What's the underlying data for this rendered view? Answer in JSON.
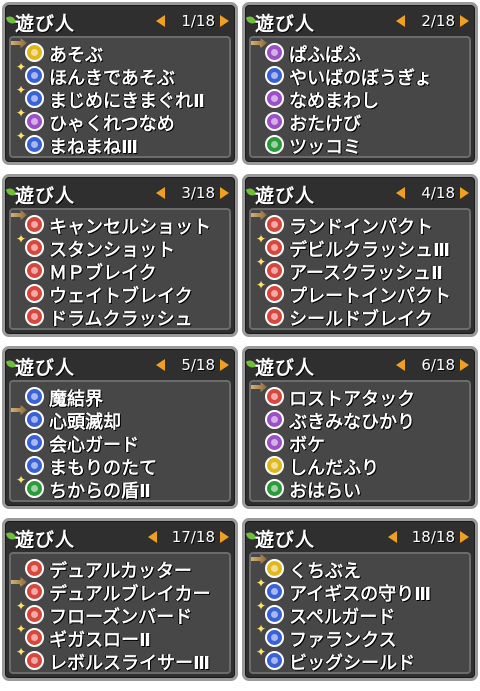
{
  "colors": {
    "red": "#d9463c",
    "blue": "#3a62d8",
    "yellow": "#e1b81c",
    "purple": "#9d4fc7",
    "green": "#2a9a3a"
  },
  "panels": [
    {
      "title": "遊び人",
      "page": "1/18",
      "cursor": 0,
      "items": [
        {
          "label": "あそぶ",
          "icon": "yellow-icon",
          "sparkle": false
        },
        {
          "label": "ほんきであそぶ",
          "icon": "blue-icon",
          "sparkle": true
        },
        {
          "label": "まじめにきまぐれⅡ",
          "icon": "blue-icon",
          "sparkle": true
        },
        {
          "label": "ひゃくれつなめ",
          "icon": "purple-icon",
          "sparkle": true
        },
        {
          "label": "まねまねⅢ",
          "icon": "blue-icon",
          "sparkle": true
        }
      ]
    },
    {
      "title": "遊び人",
      "page": "2/18",
      "cursor": 0,
      "items": [
        {
          "label": "ぱふぱふ",
          "icon": "purple-icon",
          "sparkle": true
        },
        {
          "label": "やいばのぼうぎょ",
          "icon": "blue-icon",
          "sparkle": false
        },
        {
          "label": "なめまわし",
          "icon": "purple-icon",
          "sparkle": false
        },
        {
          "label": "おたけび",
          "icon": "purple-icon",
          "sparkle": false
        },
        {
          "label": "ツッコミ",
          "icon": "green-icon",
          "sparkle": false
        }
      ]
    },
    {
      "title": "遊び人",
      "page": "3/18",
      "cursor": 0,
      "items": [
        {
          "label": "キャンセルショット",
          "icon": "red-icon",
          "sparkle": false
        },
        {
          "label": "スタンショット",
          "icon": "red-icon",
          "sparkle": true
        },
        {
          "label": "ＭＰブレイク",
          "icon": "red-icon",
          "sparkle": false
        },
        {
          "label": "ウェイトブレイク",
          "icon": "red-icon",
          "sparkle": false
        },
        {
          "label": "ドラムクラッシュ",
          "icon": "red-icon",
          "sparkle": false
        }
      ]
    },
    {
      "title": "遊び人",
      "page": "4/18",
      "cursor": 0,
      "items": [
        {
          "label": "ランドインパクト",
          "icon": "red-icon",
          "sparkle": false
        },
        {
          "label": "デビルクラッシュⅢ",
          "icon": "red-icon",
          "sparkle": true
        },
        {
          "label": "アースクラッシュⅡ",
          "icon": "red-icon",
          "sparkle": true
        },
        {
          "label": "プレートインパクト",
          "icon": "red-icon",
          "sparkle": true
        },
        {
          "label": "シールドブレイク",
          "icon": "red-icon",
          "sparkle": false
        }
      ]
    },
    {
      "title": "遊び人",
      "page": "5/18",
      "cursor": 1,
      "items": [
        {
          "label": "魔結界",
          "icon": "blue-icon",
          "sparkle": false
        },
        {
          "label": "心頭滅却",
          "icon": "blue-icon",
          "sparkle": false
        },
        {
          "label": "会心ガード",
          "icon": "blue-icon",
          "sparkle": false
        },
        {
          "label": "まもりのたて",
          "icon": "blue-icon",
          "sparkle": false
        },
        {
          "label": "ちからの盾Ⅱ",
          "icon": "green-icon",
          "sparkle": true
        }
      ]
    },
    {
      "title": "遊び人",
      "page": "6/18",
      "cursor": 0,
      "items": [
        {
          "label": "ロストアタック",
          "icon": "red-icon",
          "sparkle": false
        },
        {
          "label": "ぶきみなひかり",
          "icon": "purple-icon",
          "sparkle": false
        },
        {
          "label": "ボケ",
          "icon": "purple-icon",
          "sparkle": false
        },
        {
          "label": "しんだふり",
          "icon": "yellow-icon",
          "sparkle": false
        },
        {
          "label": "おはらい",
          "icon": "green-icon",
          "sparkle": false
        }
      ]
    },
    {
      "title": "遊び人",
      "page": "17/18",
      "cursor": 1,
      "items": [
        {
          "label": "デュアルカッター",
          "icon": "red-icon",
          "sparkle": false
        },
        {
          "label": "デュアルブレイカー",
          "icon": "red-icon",
          "sparkle": true
        },
        {
          "label": "フローズンバード",
          "icon": "red-icon",
          "sparkle": true
        },
        {
          "label": "ギガスローⅡ",
          "icon": "red-icon",
          "sparkle": true
        },
        {
          "label": "レボルスライサーⅢ",
          "icon": "red-icon",
          "sparkle": true
        }
      ]
    },
    {
      "title": "遊び人",
      "page": "18/18",
      "cursor": 0,
      "items": [
        {
          "label": "くちぶえ",
          "icon": "yellow-icon",
          "sparkle": false
        },
        {
          "label": "アイギスの守りⅢ",
          "icon": "blue-icon",
          "sparkle": true
        },
        {
          "label": "スペルガード",
          "icon": "blue-icon",
          "sparkle": true
        },
        {
          "label": "ファランクス",
          "icon": "blue-icon",
          "sparkle": true
        },
        {
          "label": "ビッグシールド",
          "icon": "blue-icon",
          "sparkle": true
        }
      ]
    }
  ]
}
